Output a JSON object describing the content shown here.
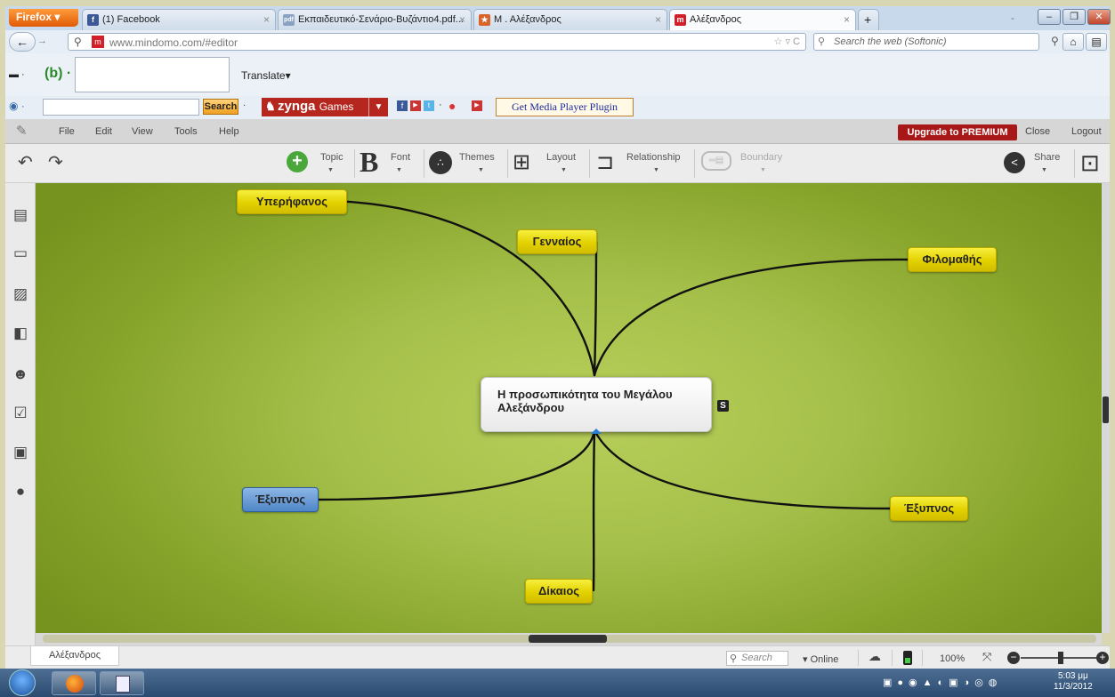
{
  "browser": {
    "menu_label": "Firefox",
    "tabs": [
      {
        "label": "(1) Facebook",
        "icon": "facebook-icon"
      },
      {
        "label": "Εκπαιδευτικό-Σενάριο-Βυζάντιο4.pdf...",
        "icon": "pdf-icon"
      },
      {
        "label": "Μ . Αλέξανδρος",
        "icon": "page-icon"
      },
      {
        "label": "Αλέξανδρος",
        "icon": "mindomo-icon",
        "active": true
      }
    ],
    "new_tab": "+",
    "url": "www.mindomo.com/#editor",
    "search_placeholder": "Search the web (Softonic)"
  },
  "toolbar1": {
    "translate_label": "Translate"
  },
  "toolbar2": {
    "search_button": "Search",
    "zynga_label": "zynga",
    "zynga_sub": "Games",
    "media_plugin": "Get Media Player Plugin"
  },
  "app_menu": {
    "items": [
      "File",
      "Edit",
      "View",
      "Tools",
      "Help"
    ],
    "upgrade": "Upgrade to PREMIUM",
    "close": "Close",
    "logout": "Logout"
  },
  "app_toolbar": {
    "topic": "Topic",
    "font": "Font",
    "themes": "Themes",
    "layout": "Layout",
    "relationship": "Relationship",
    "boundary": "Boundary",
    "share": "Share"
  },
  "mindmap": {
    "central": "Η προσωπικότητα του Μεγάλου Αλεξάνδρου",
    "badge": "S",
    "topics": [
      {
        "label": "Υπερήφανος",
        "style": "yellow"
      },
      {
        "label": "Γενναίος",
        "style": "yellow"
      },
      {
        "label": "Φιλομαθής",
        "style": "yellow"
      },
      {
        "label": "Έξυπνος",
        "style": "blue"
      },
      {
        "label": "Έξυπνος",
        "style": "yellow"
      },
      {
        "label": "Δίκαιος",
        "style": "yellow"
      }
    ]
  },
  "statusbar": {
    "map_tab": "Αλέξανδρος",
    "search_placeholder": "Search",
    "online": "Online",
    "zoom": "100%"
  },
  "taskbar": {
    "time": "5:03 μμ",
    "date": "11/3/2012"
  },
  "colors": {
    "canvas_center": "#b7cf5a",
    "canvas_edge": "#76931f",
    "node_yellow": "#e3d100",
    "node_blue": "#4f86c6",
    "upgrade_red": "#a81818"
  }
}
